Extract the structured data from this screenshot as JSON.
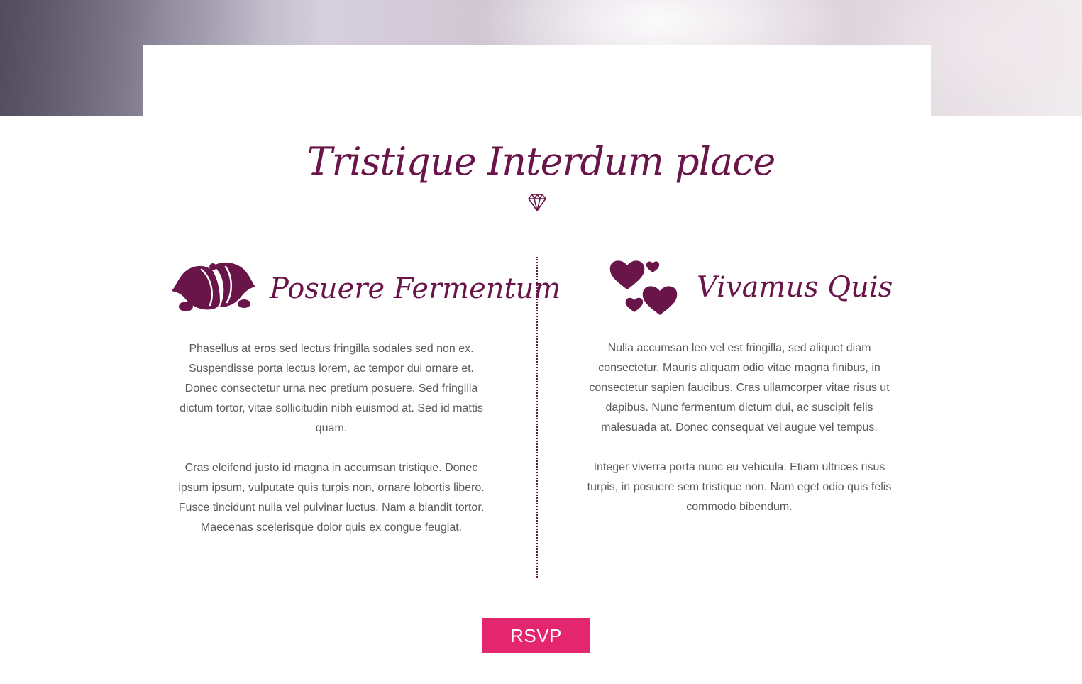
{
  "section": {
    "title": "Tristique Interdum place"
  },
  "columns": [
    {
      "heading": "Posuere Fermentum",
      "icon": "wedding-bells-icon",
      "paragraphs": [
        "Phasellus at eros sed lectus fringilla sodales sed non ex. Suspendisse porta lectus lorem, ac tempor dui ornare et. Donec consectetur urna nec pretium posuere. Sed fringilla dictum tortor, vitae sollicitudin nibh euismod at. Sed id mattis quam.",
        "Cras eleifend justo id magna in accumsan tristique. Donec ipsum ipsum, vulputate quis turpis non, ornare lobortis libero. Fusce tincidunt nulla vel pulvinar luctus. Nam a blandit tortor. Maecenas scelerisque dolor quis ex congue feugiat."
      ]
    },
    {
      "heading": "Vivamus  Quis",
      "icon": "hearts-icon",
      "paragraphs": [
        "Nulla accumsan leo vel est fringilla, sed aliquet diam consectetur. Mauris aliquam odio vitae magna finibus, in consectetur sapien faucibus. Cras ullamcorper vitae risus ut dapibus. Nunc fermentum dictum dui, ac suscipit felis malesuada at. Donec consequat vel augue vel tempus.",
        "Integer viverra porta nunc eu vehicula. Etiam ultrices risus turpis, in posuere sem tristique non. Nam eget odio quis felis commodo bibendum."
      ]
    }
  ],
  "rsvp": {
    "label": "RSVP"
  },
  "colors": {
    "accent": "#6a1549",
    "button": "#e4266e",
    "text": "#5a5a5a"
  },
  "icons": {
    "title_ornament": "diamond-icon"
  }
}
